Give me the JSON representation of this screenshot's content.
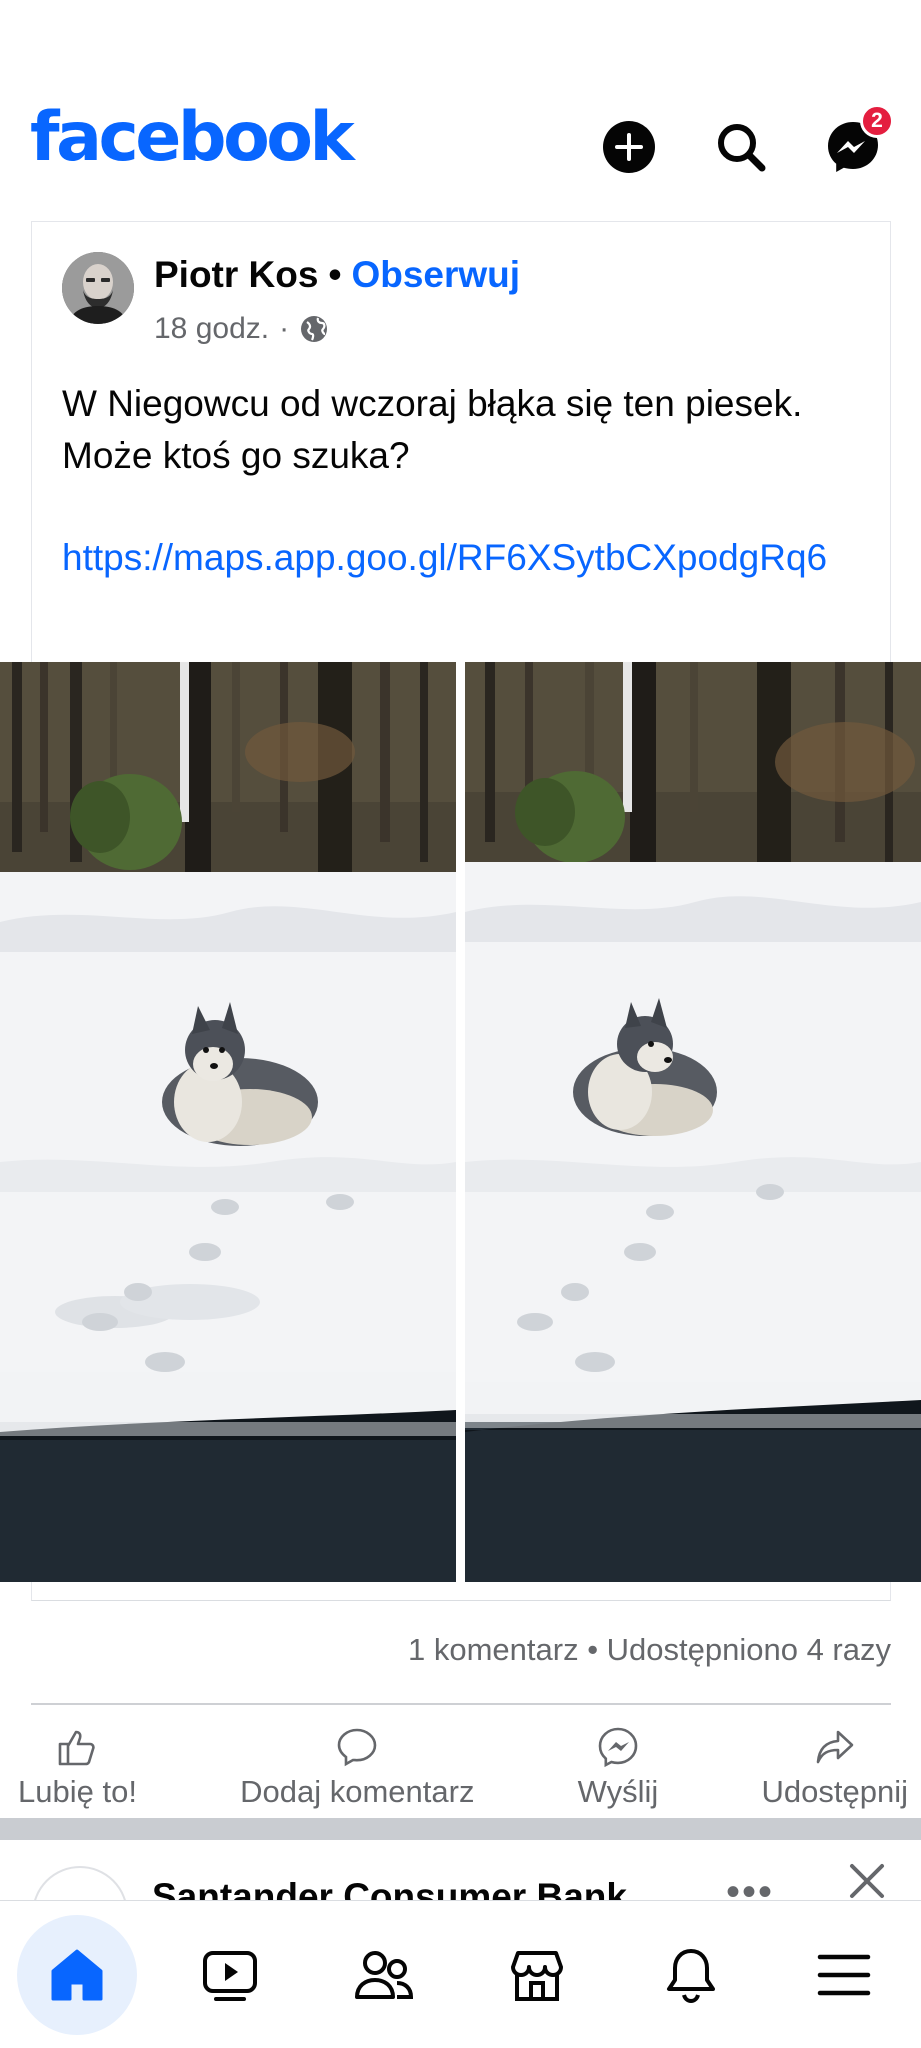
{
  "header": {
    "logo_text": "facebook",
    "messenger_badge": "2"
  },
  "post": {
    "author": "Piotr Kos",
    "separator": "•",
    "follow_label": "Obserwuj",
    "time": "18 godz.",
    "time_separator": "·",
    "text": "W Niegowcu od wczoraj błąka się ten piesek. Może ktoś go szuka?",
    "link": "https://maps.app.goo.gl/RF6XSytbCXpodgRq6",
    "stats": "1 komentarz • Udostępniono 4 razy",
    "actions": {
      "like": "Lubię to!",
      "comment": "Dodaj komentarz",
      "send": "Wyślij",
      "share": "Udostępnij"
    }
  },
  "next_post": {
    "author": "Santander Consumer Bank",
    "more": "•••"
  },
  "colors": {
    "brand": "#0866ff",
    "badge": "#e41e3f",
    "secondary_text": "#65676b"
  }
}
